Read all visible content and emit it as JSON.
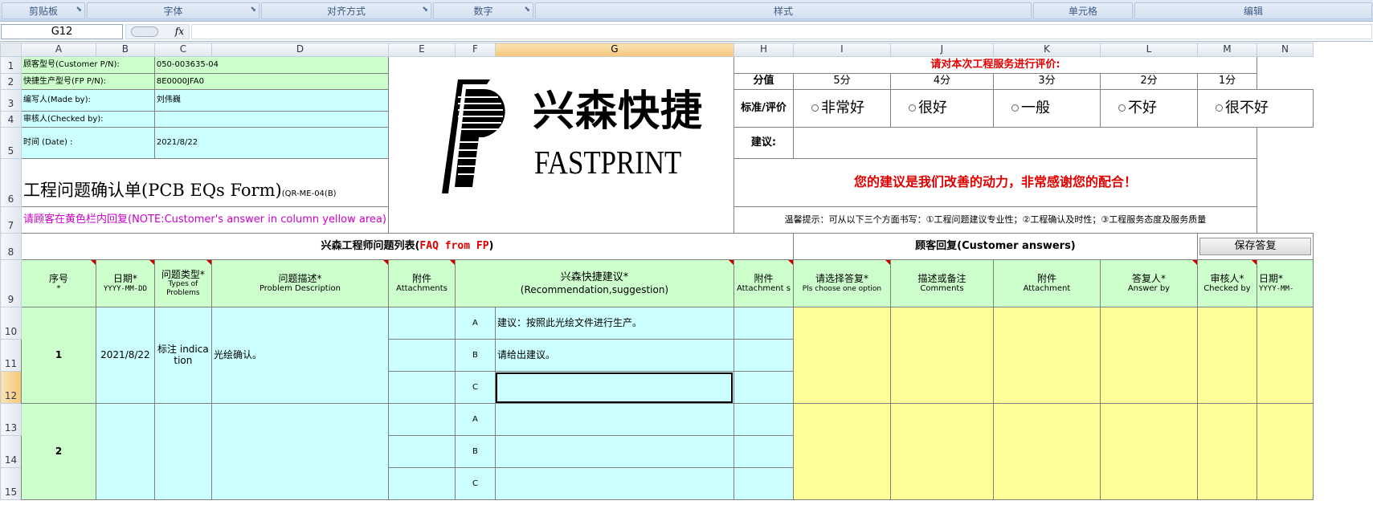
{
  "ribbon": {
    "groups": [
      {
        "label": "剪贴板"
      },
      {
        "label": "字体"
      },
      {
        "label": "对齐方式"
      },
      {
        "label": "数字"
      },
      {
        "label": "样式"
      },
      {
        "label": "单元格"
      },
      {
        "label": "编辑"
      }
    ],
    "launcher_icon": "dialog-launcher-icon"
  },
  "formula_bar": {
    "name_box": "G12",
    "fx_label": "fx",
    "formula": ""
  },
  "columns": [
    "A",
    "B",
    "C",
    "D",
    "E",
    "F",
    "G",
    "H",
    "I",
    "J",
    "K",
    "L",
    "M",
    "N"
  ],
  "selected_column": "G",
  "rows": [
    "1",
    "2",
    "3",
    "4",
    "5",
    "6",
    "7",
    "8",
    "9",
    "10",
    "11",
    "12",
    "13",
    "14",
    "15"
  ],
  "selected_row": "12",
  "header_info": {
    "customer_pn_label": "顾客型号(Customer P/N):",
    "customer_pn_value": "050-003635-04",
    "fp_pn_label": "快捷生产型号(FP P/N):",
    "fp_pn_value": "8E0000JFA0",
    "made_by_label": "编写人(Made by):",
    "made_by_value": "刘伟巍",
    "checked_by_label": "审核人(Checked by):",
    "checked_by_value": "",
    "date_label": "时间 (Date) :",
    "date_value": "2021/8/22",
    "form_title": "工程问题确认单(PCB EQs Form)",
    "form_code": "(QR-ME-04(B)",
    "note": "请顾客在黄色栏内回复(NOTE:Customer's answer in column yellow area)"
  },
  "logo": {
    "cn_name": "兴森快捷",
    "en_name": "FASTPRINT",
    "colors": {
      "ink": "#000000"
    }
  },
  "rating": {
    "title": "请对本次工程服务进行评价:",
    "score_label": "分值",
    "scores": [
      "5分",
      "4分",
      "3分",
      "2分",
      "1分"
    ],
    "criteria_label": "标准/评价",
    "options": [
      "非常好",
      "很好",
      "一般",
      "不好",
      "很不好"
    ],
    "suggestion_label": "建议:",
    "thanks": "您的建议是我们改善的动力，非常感谢您的配合！",
    "tip": "温馨提示：可从以下三个方面书写：①工程问题建议专业性；②工程确认及时性；③工程服务态度及服务质量"
  },
  "faq": {
    "title_cn": "兴森工程师问题列表(",
    "title_en": "FAQ from FP",
    "title_close": ")",
    "customer_title": "顾客回复(Customer answers)",
    "save_button": "保存答复"
  },
  "col_headers": {
    "no": {
      "cn": "序号",
      "en": "*"
    },
    "date": {
      "cn": "日期*",
      "en": "YYYY-MM-DD"
    },
    "type": {
      "cn": "问题类型*",
      "en": "Types of Problems"
    },
    "desc": {
      "cn": "问题描述*",
      "en": "Problem Description"
    },
    "attach": {
      "cn": "附件",
      "en": "Attachments"
    },
    "suggest": {
      "cn": "兴森快捷建议*",
      "en": "(Recommendation,suggestion)"
    },
    "attach2": {
      "cn": "附件",
      "en": "Attachment s"
    },
    "choose": {
      "cn": "请选择答复*",
      "en": "Pls choose one option"
    },
    "comments": {
      "cn": "描述或备注",
      "en": "Comments"
    },
    "attach3": {
      "cn": "附件",
      "en": "Attachment"
    },
    "answer_by": {
      "cn": "答复人*",
      "en": "Answer by"
    },
    "checked_by": {
      "cn": "审核人*",
      "en": "Checked by"
    },
    "date2": {
      "cn": "日期*",
      "en": "YYYY-MM-"
    }
  },
  "items": [
    {
      "no": "1",
      "date": "2021/8/22",
      "type": "标注 indication",
      "desc": "光绘确认。",
      "options": [
        {
          "letter": "A",
          "text": "建议：按照此光绘文件进行生产。"
        },
        {
          "letter": "B",
          "text": "请给出建议。"
        },
        {
          "letter": "C",
          "text": ""
        }
      ]
    },
    {
      "no": "2",
      "date": "",
      "type": "",
      "desc": "",
      "options": [
        {
          "letter": "A",
          "text": ""
        },
        {
          "letter": "B",
          "text": ""
        },
        {
          "letter": "C",
          "text": ""
        }
      ]
    }
  ],
  "colors": {
    "green_fill": "#ccffcc",
    "cyan_fill": "#ccffff",
    "yellow_fill": "#ffff99",
    "red_text": "#e00000",
    "magenta_text": "#cc00cc",
    "selected_header": "#f6c77a"
  }
}
